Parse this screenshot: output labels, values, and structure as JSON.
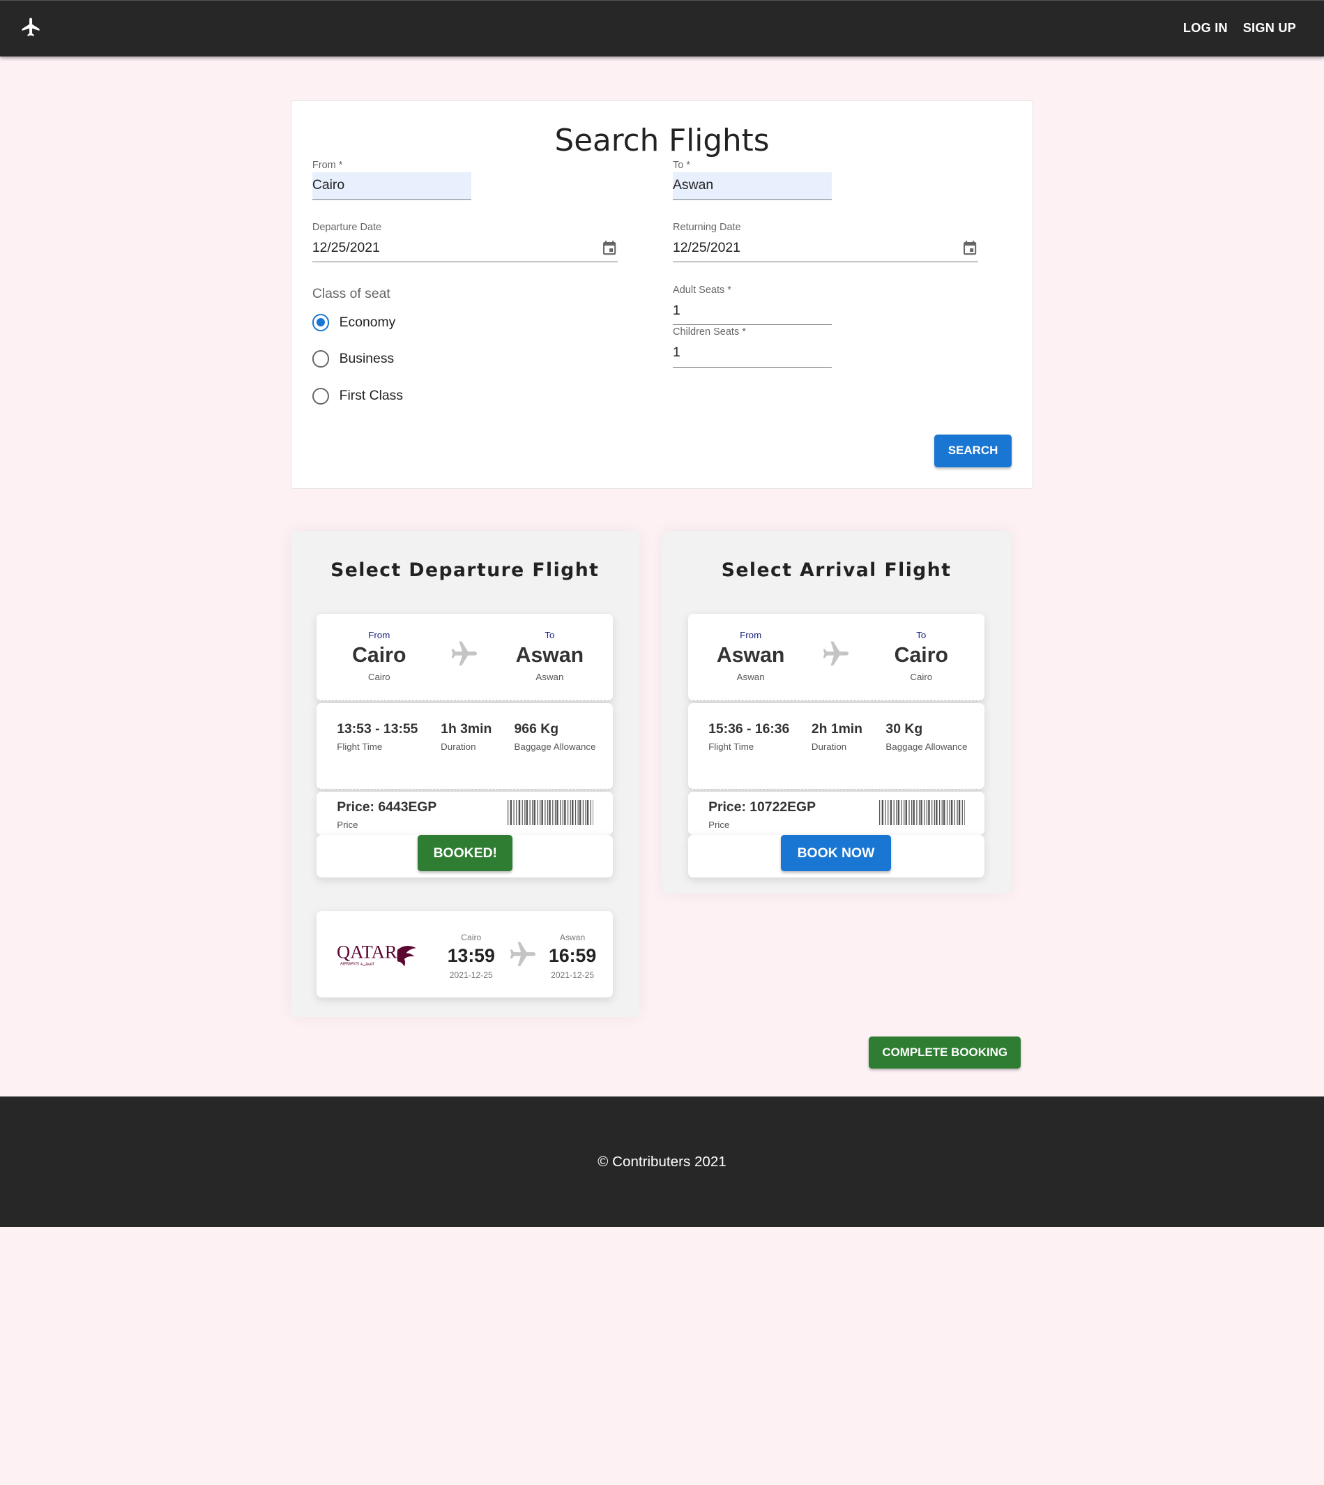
{
  "nav": {
    "login": "LOG IN",
    "signup": "SIGN UP"
  },
  "search": {
    "title": "Search Flights",
    "from_label": "From *",
    "from_value": "Cairo",
    "to_label": "To *",
    "to_value": "Aswan",
    "departure_label": "Departure Date",
    "departure_value": "12/25/2021",
    "returning_label": "Returning Date",
    "returning_value": "12/25/2021",
    "class_label": "Class of seat",
    "classes": [
      "Economy",
      "Business",
      "First Class"
    ],
    "selected_class": "Economy",
    "adult_label": "Adult Seats *",
    "adult_value": "1",
    "children_label": "Children Seats *",
    "children_value": "1",
    "search_button": "SEARCH"
  },
  "departure": {
    "title": "Select Departure Flight",
    "from_label": "From",
    "from_city": "Cairo",
    "from_sub": "Cairo",
    "to_label": "To",
    "to_city": "Aswan",
    "to_sub": "Aswan",
    "flight_time": "13:53 - 13:55",
    "flight_time_label": "Flight Time",
    "duration": "1h 3min",
    "duration_label": "Duration",
    "baggage": "966 Kg",
    "baggage_label": "Baggage Allowance",
    "price": "Price: 6443EGP",
    "price_label": "Price",
    "button": "BOOKED!",
    "summary": {
      "airline": "Qatar Airways",
      "from_city": "Cairo",
      "dep_time": "13:59",
      "dep_date": "2021-12-25",
      "to_city": "Aswan",
      "arr_time": "16:59",
      "arr_date": "2021-12-25"
    }
  },
  "arrival": {
    "title": "Select Arrival Flight",
    "from_label": "From",
    "from_city": "Aswan",
    "from_sub": "Aswan",
    "to_label": "To",
    "to_city": "Cairo",
    "to_sub": "Cairo",
    "flight_time": "15:36 - 16:36",
    "flight_time_label": "Flight Time",
    "duration": "2h 1min",
    "duration_label": "Duration",
    "baggage": "30 Kg",
    "baggage_label": "Baggage Allowance",
    "price": "Price: 10722EGP",
    "price_label": "Price",
    "button": "BOOK NOW"
  },
  "complete_button": "COMPLETE BOOKING",
  "footer": "© Contributers 2021",
  "colors": {
    "primary": "#1976d2",
    "success": "#2e7d32",
    "bar": "#272727",
    "background": "#fdf1f4"
  },
  "icons": {
    "logo": "airplane-icon",
    "calendar": "calendar-icon",
    "plane": "plane-icon"
  }
}
